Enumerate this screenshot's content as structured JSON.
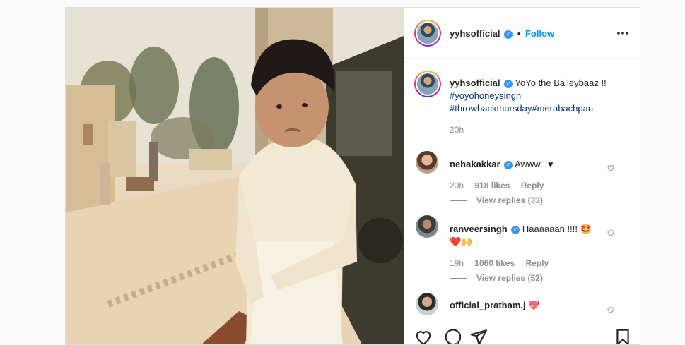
{
  "post": {
    "author": "yyhsofficial",
    "follow_label": "Follow",
    "dot": "•",
    "more_icon": "more-dots-icon"
  },
  "caption": {
    "username": "yyhsofficial",
    "text": "YoYo the Balleybaaz !!",
    "tags": [
      "#yoyohoneysingh",
      "#throwbackthursday#merabachpan"
    ],
    "time": "20h"
  },
  "comments": [
    {
      "username": "nehakakkar",
      "verified": true,
      "text": "Awww.. ♥",
      "time": "20h",
      "likes": "918 likes",
      "reply": "Reply",
      "view_replies": "View replies (33)"
    },
    {
      "username": "ranveersingh",
      "verified": true,
      "text": "Haaaaaan !!!! 🤩",
      "text2": "❤️🙌",
      "time": "19h",
      "likes": "1060 likes",
      "reply": "Reply",
      "view_replies": "View replies (52)"
    },
    {
      "username": "official_pratham.j",
      "verified": false,
      "text": "💖"
    }
  ],
  "colors": {
    "link_blue": "#0095f6",
    "hashtag": "#00376b",
    "muted": "#8e8e8e"
  }
}
